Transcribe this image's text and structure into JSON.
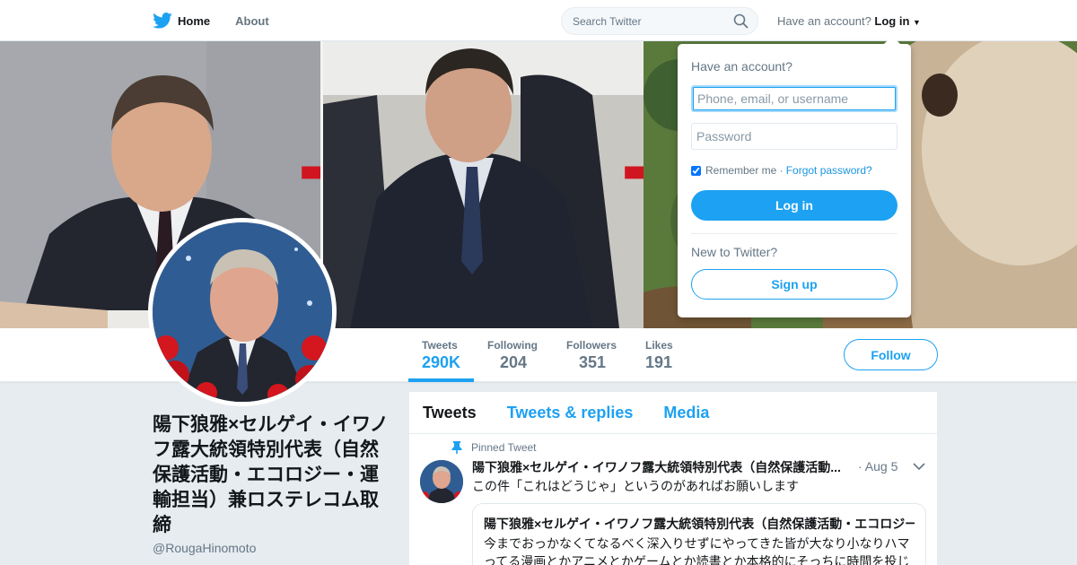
{
  "nav": {
    "home_label": "Home",
    "about_label": "About",
    "search_placeholder": "Search Twitter",
    "have_account_text": "Have an account?",
    "login_label": "Log in"
  },
  "profile": {
    "name": "陽下狼雅×セルゲイ・イワノフ露大統領特別代表（自然保護活動・エコロジー・運輸担当）兼ロステレコム取締",
    "handle": "@RougaHinomoto",
    "follow_label": "Follow",
    "stats": [
      {
        "label": "Tweets",
        "value": "290K"
      },
      {
        "label": "Following",
        "value": "204"
      },
      {
        "label": "Followers",
        "value": "351"
      },
      {
        "label": "Likes",
        "value": "191"
      }
    ]
  },
  "banner": {
    "arrow_glyph": "➡"
  },
  "timeline": {
    "tabs": [
      "Tweets",
      "Tweets & replies",
      "Media"
    ],
    "pinned_label": "Pinned Tweet",
    "tweet": {
      "author": "陽下狼雅×セルゲイ・イワノフ露大統領特別代表（自然保護活動...",
      "date": "· Aug 5",
      "text": "この件「これはどうじゃ」というのがあればお願いします",
      "quote_author": "陽下狼雅×セルゲイ・イワノフ露大統領特別代表（自然保護活動・エコロジー",
      "quote_text": "今までおっかなくてなるべく深入りせずにやってきた皆が大なり小なりハマってる漫画とかアニメとかゲームとか読書とか本格的にそっちに時間を投じ"
    }
  },
  "login_dropdown": {
    "heading": "Have an account?",
    "username_placeholder": "Phone, email, or username",
    "password_placeholder": "Password",
    "remember_label": "Remember me ·",
    "forgot_label": "Forgot password?",
    "login_button": "Log in",
    "new_label": "New to Twitter?",
    "signup_button": "Sign up"
  },
  "colors": {
    "accent": "#1da1f2",
    "background": "#e6ecf0"
  }
}
